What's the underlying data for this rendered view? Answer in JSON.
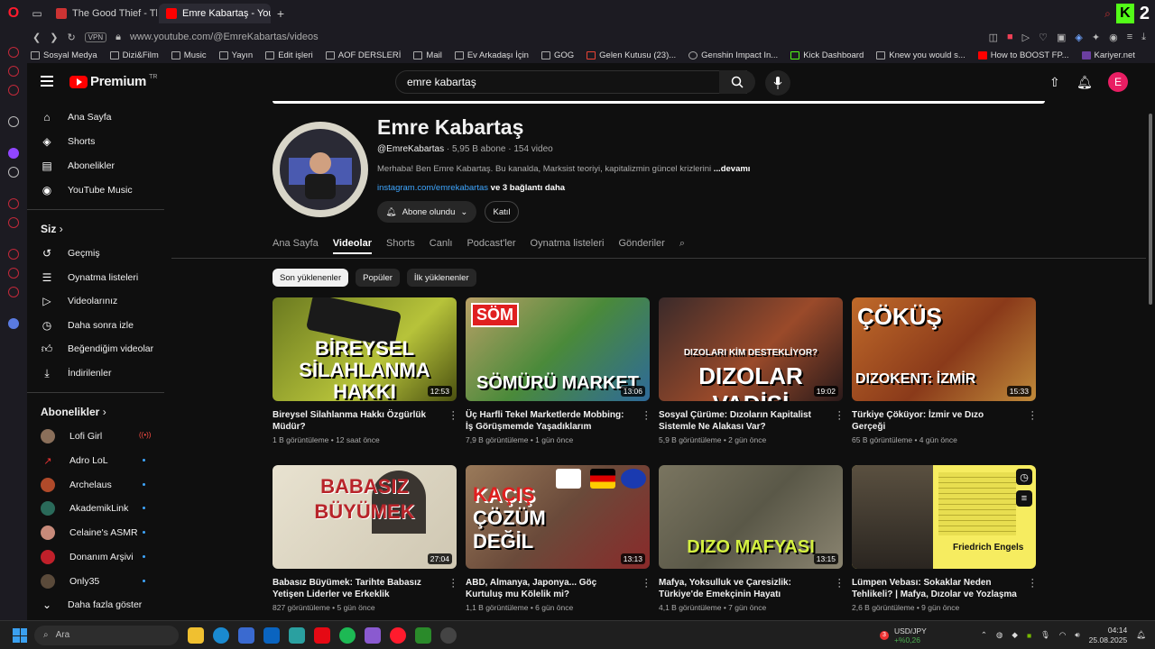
{
  "browser": {
    "tabs": [
      {
        "label": "The Good Thief - The Offi",
        "active": false
      },
      {
        "label": "Emre Kabartaş - YouTube",
        "active": true
      }
    ],
    "url": "www.youtube.com/@EmreKabartas/videos",
    "vpn": "VPN",
    "k_badge": "K",
    "k_count": "2",
    "bookmarks": [
      "Sosyal Medya",
      "Dizi&Film",
      "Music",
      "Yayın",
      "Edit işleri",
      "AOF DERSLERİ",
      "Mail",
      "Ev Arkadaşı İçin",
      "GOG",
      "Gelen Kutusu (23)...",
      "Genshin Impact In...",
      "Kick Dashboard",
      "Knew you would s...",
      "How to BOOST FP...",
      "Kariyer.net"
    ]
  },
  "youtube": {
    "logo": "Premium",
    "logo_sup": "TR",
    "search_value": "emre kabartaş",
    "avatar_letter": "E",
    "nav": {
      "main": [
        "Ana Sayfa",
        "Shorts",
        "Abonelikler",
        "YouTube Music"
      ],
      "you_title": "Siz",
      "you": [
        "Geçmiş",
        "Oynatma listeleri",
        "Videolarınız",
        "Daha sonra izle",
        "Beğendiğim videolar",
        "İndirilenler"
      ],
      "subs_title": "Abonelikler",
      "subs": [
        "Lofi Girl",
        "Adro LoL",
        "Archelaus",
        "AkademikLink",
        "Celaine's ASMR",
        "Donanım Arşivi",
        "Only35"
      ],
      "more": "Daha fazla göster"
    },
    "channel": {
      "name": "Emre Kabartaş",
      "handle": "@EmreKabartas",
      "stats": " · 5,95 B abone · 154 video",
      "desc": "Merhaba! Ben Emre Kabartaş. Bu kanalda, Marksist teoriyi, kapitalizmin güncel krizlerini ",
      "more": "...devamı",
      "link": "instagram.com/emrekabartas",
      "link_more": " ve 3 bağlantı daha",
      "subscribed": "Abone olundu",
      "join": "Katıl",
      "tabs": [
        "Ana Sayfa",
        "Videolar",
        "Shorts",
        "Canlı",
        "Podcast'ler",
        "Oynatma listeleri",
        "Gönderiler"
      ],
      "chips": [
        "Son yüklenenler",
        "Popüler",
        "İlk yüklenenler"
      ]
    },
    "videos": [
      {
        "title": "Bireysel Silahlanma Hakkı Özgürlük Müdür?",
        "meta": "1 B görüntüleme • 12 saat önce",
        "dur": "12:53",
        "thumb": "BİREYSEL SİLAHLANMA HAKKI"
      },
      {
        "title": "Üç Harfli Tekel Marketlerde Mobbing: İş Görüşmemde Yaşadıklarım",
        "meta": "7,9 B görüntüleme • 1 gün önce",
        "dur": "13:06",
        "thumb": "SÖMÜRÜ MARKET",
        "badge": "SÖM"
      },
      {
        "title": "Sosyal Çürüme: Dızoların Kapitalist Sistemle Ne Alakası Var?",
        "meta": "5,9 B görüntüleme • 2 gün önce",
        "dur": "19:02",
        "thumb": "DIZOLAR VADİSİ",
        "sub": "DIZOLARI KİM DESTEKLİYOR?"
      },
      {
        "title": "Türkiye Çöküyor: İzmir ve Dızo Gerçeği",
        "meta": "65 B görüntüleme • 4 gün önce",
        "dur": "15:33",
        "thumb": "DIZOKENT: İZMİR",
        "badge": "ÇÖKÜŞ"
      },
      {
        "title": "Babasız Büyümek: Tarihte Babasız Yetişen Liderler ve Erkeklik",
        "meta": "827 görüntüleme • 5 gün önce",
        "dur": "27:04",
        "thumb": "BABASIZ BÜYÜMEK"
      },
      {
        "title": "ABD, Almanya, Japonya... Göç Kurtuluş mu Kölelik mi?",
        "meta": "1,1 B görüntüleme • 6 gün önce",
        "dur": "13:13",
        "thumb": "ÇÖZÜM DEĞİL",
        "badge": "KAÇIŞ"
      },
      {
        "title": "Mafya, Yoksulluk ve Çaresizlik: Türkiye'de Emekçinin Hayatı",
        "meta": "4,1 B görüntüleme • 7 gün önce",
        "dur": "13:15",
        "thumb": "DIZO MAFYASI"
      },
      {
        "title": "Lümpen Vebası: Sokaklar Neden Tehlikeli? | Mafya, Dızolar ve Yozlaşma",
        "meta": "2,6 B görüntüleme • 9 gün önce",
        "dur": "",
        "thumb": "Friedrich Engels"
      }
    ]
  },
  "taskbar": {
    "search_placeholder": "Ara",
    "ticker_name": "USD/JPY",
    "ticker_change": "+%0,26",
    "ticker_badge": "3",
    "time": "04:14",
    "date": "25.08.2025"
  }
}
